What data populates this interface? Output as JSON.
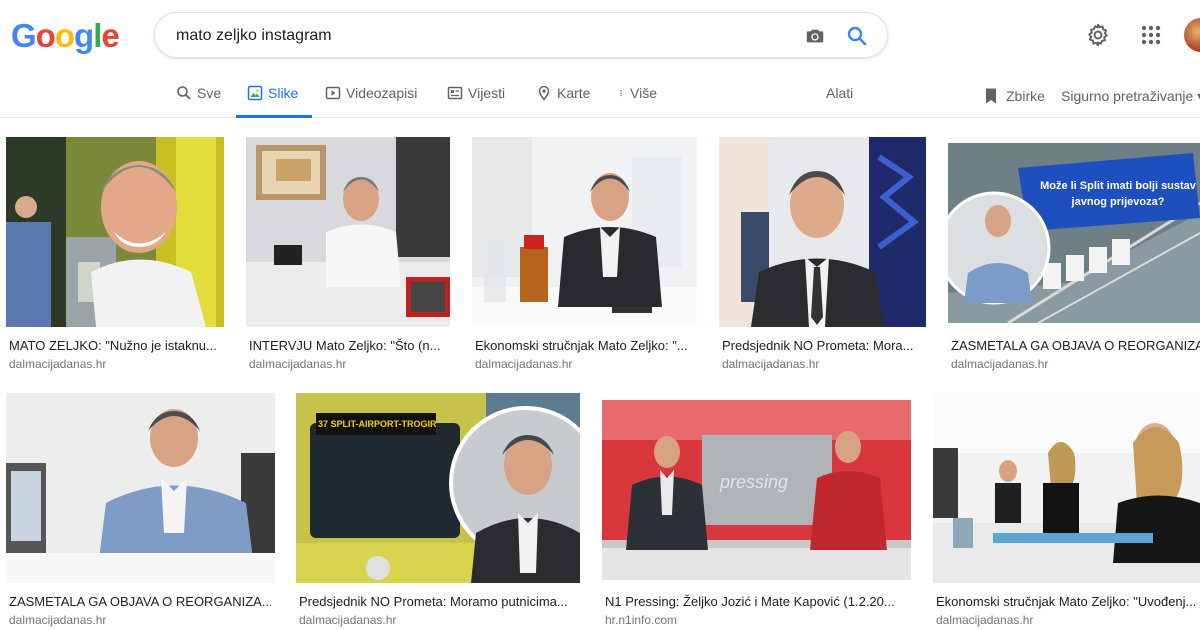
{
  "logo": "Google",
  "search": {
    "query": "mato zeljko instagram"
  },
  "tabs": {
    "sve": "Sve",
    "slike": "Slike",
    "videozapisi": "Videozapisi",
    "vijesti": "Vijesti",
    "karte": "Karte",
    "vise": "Više",
    "alati": "Alati"
  },
  "right_tools": {
    "zbirke": "Zbirke",
    "safe_search": "Sigurno pretraživanje ▾"
  },
  "colors": {
    "accent": "#1a73e8",
    "source": "#70757a"
  },
  "results": [
    {
      "title": "MATO ZELJKO: \"Nužno je istaknu...",
      "source": "dalmacijadanas.hr"
    },
    {
      "title": "INTERVJU Mato Zeljko: \"Što (n...",
      "source": "dalmacijadanas.hr"
    },
    {
      "title": "Ekonomski stručnjak Mato Zeljko: \"...",
      "source": "dalmacijadanas.hr"
    },
    {
      "title": "Predsjednik NO Prometa: Mora...",
      "source": "dalmacijadanas.hr"
    },
    {
      "title": "ZASMETALA GA OBJAVA O REORGANIZA...",
      "source": "dalmacijadanas.hr",
      "overlay_text": "Može li Split imati bolji sustav javnog prijevoza?"
    },
    {
      "title": "ZASMETALA GA OBJAVA O REORGANIZA...",
      "source": "dalmacijadanas.hr"
    },
    {
      "title": "Predsjednik NO Prometa: Moramo putnicima...",
      "source": "dalmacijadanas.hr",
      "overlay_text": "37 SPLIT-AIRPORT-TROGIR"
    },
    {
      "title": "N1 Pressing: Željko Jozić i Mate Kapović (1.2.20...",
      "source": "hr.n1info.com",
      "overlay_text": "pressing"
    },
    {
      "title": "Ekonomski stručnjak Mato Zeljko: \"Uvođenj...",
      "source": "dalmacijadanas.hr"
    }
  ]
}
